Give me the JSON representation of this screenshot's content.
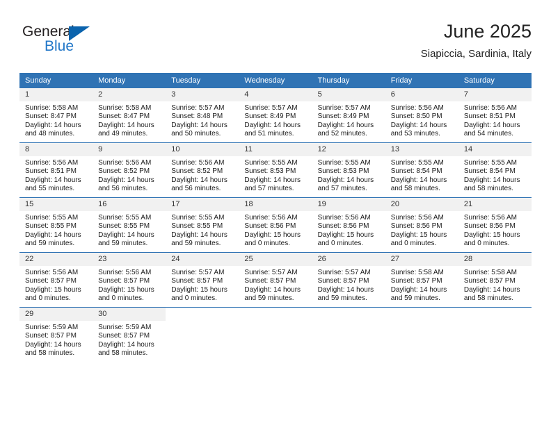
{
  "brand": {
    "name_top": "General",
    "name_bottom": "Blue",
    "color_dark": "#231f20",
    "color_blue": "#2277c8",
    "triangle_color": "#0a63ad"
  },
  "header": {
    "title": "June 2025",
    "subtitle": "Siapiccia, Sardinia, Italy"
  },
  "theme": {
    "header_blue": "#3073b4",
    "daynum_bg": "#f1f1f1",
    "grid_line": "#3073b4",
    "text": "#1a1a1a"
  },
  "labels": {
    "sunrise_prefix": "Sunrise:",
    "sunset_prefix": "Sunset:",
    "daylight_prefix": "Daylight:"
  },
  "weekday_headers": [
    "Sunday",
    "Monday",
    "Tuesday",
    "Wednesday",
    "Thursday",
    "Friday",
    "Saturday"
  ],
  "weeks": [
    [
      {
        "day": "1",
        "sunrise": "Sunrise: 5:58 AM",
        "sunset": "Sunset: 8:47 PM",
        "daylight": "Daylight: 14 hours and 48 minutes."
      },
      {
        "day": "2",
        "sunrise": "Sunrise: 5:58 AM",
        "sunset": "Sunset: 8:47 PM",
        "daylight": "Daylight: 14 hours and 49 minutes."
      },
      {
        "day": "3",
        "sunrise": "Sunrise: 5:57 AM",
        "sunset": "Sunset: 8:48 PM",
        "daylight": "Daylight: 14 hours and 50 minutes."
      },
      {
        "day": "4",
        "sunrise": "Sunrise: 5:57 AM",
        "sunset": "Sunset: 8:49 PM",
        "daylight": "Daylight: 14 hours and 51 minutes."
      },
      {
        "day": "5",
        "sunrise": "Sunrise: 5:57 AM",
        "sunset": "Sunset: 8:49 PM",
        "daylight": "Daylight: 14 hours and 52 minutes."
      },
      {
        "day": "6",
        "sunrise": "Sunrise: 5:56 AM",
        "sunset": "Sunset: 8:50 PM",
        "daylight": "Daylight: 14 hours and 53 minutes."
      },
      {
        "day": "7",
        "sunrise": "Sunrise: 5:56 AM",
        "sunset": "Sunset: 8:51 PM",
        "daylight": "Daylight: 14 hours and 54 minutes."
      }
    ],
    [
      {
        "day": "8",
        "sunrise": "Sunrise: 5:56 AM",
        "sunset": "Sunset: 8:51 PM",
        "daylight": "Daylight: 14 hours and 55 minutes."
      },
      {
        "day": "9",
        "sunrise": "Sunrise: 5:56 AM",
        "sunset": "Sunset: 8:52 PM",
        "daylight": "Daylight: 14 hours and 56 minutes."
      },
      {
        "day": "10",
        "sunrise": "Sunrise: 5:56 AM",
        "sunset": "Sunset: 8:52 PM",
        "daylight": "Daylight: 14 hours and 56 minutes."
      },
      {
        "day": "11",
        "sunrise": "Sunrise: 5:55 AM",
        "sunset": "Sunset: 8:53 PM",
        "daylight": "Daylight: 14 hours and 57 minutes."
      },
      {
        "day": "12",
        "sunrise": "Sunrise: 5:55 AM",
        "sunset": "Sunset: 8:53 PM",
        "daylight": "Daylight: 14 hours and 57 minutes."
      },
      {
        "day": "13",
        "sunrise": "Sunrise: 5:55 AM",
        "sunset": "Sunset: 8:54 PM",
        "daylight": "Daylight: 14 hours and 58 minutes."
      },
      {
        "day": "14",
        "sunrise": "Sunrise: 5:55 AM",
        "sunset": "Sunset: 8:54 PM",
        "daylight": "Daylight: 14 hours and 58 minutes."
      }
    ],
    [
      {
        "day": "15",
        "sunrise": "Sunrise: 5:55 AM",
        "sunset": "Sunset: 8:55 PM",
        "daylight": "Daylight: 14 hours and 59 minutes."
      },
      {
        "day": "16",
        "sunrise": "Sunrise: 5:55 AM",
        "sunset": "Sunset: 8:55 PM",
        "daylight": "Daylight: 14 hours and 59 minutes."
      },
      {
        "day": "17",
        "sunrise": "Sunrise: 5:55 AM",
        "sunset": "Sunset: 8:55 PM",
        "daylight": "Daylight: 14 hours and 59 minutes."
      },
      {
        "day": "18",
        "sunrise": "Sunrise: 5:56 AM",
        "sunset": "Sunset: 8:56 PM",
        "daylight": "Daylight: 15 hours and 0 minutes."
      },
      {
        "day": "19",
        "sunrise": "Sunrise: 5:56 AM",
        "sunset": "Sunset: 8:56 PM",
        "daylight": "Daylight: 15 hours and 0 minutes."
      },
      {
        "day": "20",
        "sunrise": "Sunrise: 5:56 AM",
        "sunset": "Sunset: 8:56 PM",
        "daylight": "Daylight: 15 hours and 0 minutes."
      },
      {
        "day": "21",
        "sunrise": "Sunrise: 5:56 AM",
        "sunset": "Sunset: 8:56 PM",
        "daylight": "Daylight: 15 hours and 0 minutes."
      }
    ],
    [
      {
        "day": "22",
        "sunrise": "Sunrise: 5:56 AM",
        "sunset": "Sunset: 8:57 PM",
        "daylight": "Daylight: 15 hours and 0 minutes."
      },
      {
        "day": "23",
        "sunrise": "Sunrise: 5:56 AM",
        "sunset": "Sunset: 8:57 PM",
        "daylight": "Daylight: 15 hours and 0 minutes."
      },
      {
        "day": "24",
        "sunrise": "Sunrise: 5:57 AM",
        "sunset": "Sunset: 8:57 PM",
        "daylight": "Daylight: 15 hours and 0 minutes."
      },
      {
        "day": "25",
        "sunrise": "Sunrise: 5:57 AM",
        "sunset": "Sunset: 8:57 PM",
        "daylight": "Daylight: 14 hours and 59 minutes."
      },
      {
        "day": "26",
        "sunrise": "Sunrise: 5:57 AM",
        "sunset": "Sunset: 8:57 PM",
        "daylight": "Daylight: 14 hours and 59 minutes."
      },
      {
        "day": "27",
        "sunrise": "Sunrise: 5:58 AM",
        "sunset": "Sunset: 8:57 PM",
        "daylight": "Daylight: 14 hours and 59 minutes."
      },
      {
        "day": "28",
        "sunrise": "Sunrise: 5:58 AM",
        "sunset": "Sunset: 8:57 PM",
        "daylight": "Daylight: 14 hours and 58 minutes."
      }
    ],
    [
      {
        "day": "29",
        "sunrise": "Sunrise: 5:59 AM",
        "sunset": "Sunset: 8:57 PM",
        "daylight": "Daylight: 14 hours and 58 minutes."
      },
      {
        "day": "30",
        "sunrise": "Sunrise: 5:59 AM",
        "sunset": "Sunset: 8:57 PM",
        "daylight": "Daylight: 14 hours and 58 minutes."
      },
      {
        "day": "",
        "sunrise": "",
        "sunset": "",
        "daylight": ""
      },
      {
        "day": "",
        "sunrise": "",
        "sunset": "",
        "daylight": ""
      },
      {
        "day": "",
        "sunrise": "",
        "sunset": "",
        "daylight": ""
      },
      {
        "day": "",
        "sunrise": "",
        "sunset": "",
        "daylight": ""
      },
      {
        "day": "",
        "sunrise": "",
        "sunset": "",
        "daylight": ""
      }
    ]
  ]
}
